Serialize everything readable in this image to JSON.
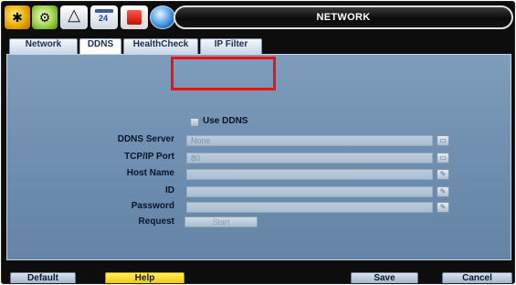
{
  "window": {
    "title": "NETWORK"
  },
  "toolbar": {
    "icons": [
      {
        "name": "setup-icon"
      },
      {
        "name": "gear-icon"
      },
      {
        "name": "alarm-bell-icon"
      },
      {
        "name": "calendar-icon",
        "text": "24"
      },
      {
        "name": "record-icon"
      },
      {
        "name": "network-globe-icon"
      }
    ]
  },
  "tabs": [
    {
      "label": "Network",
      "active": false
    },
    {
      "label": "DDNS",
      "active": true
    },
    {
      "label": "HealthCheck",
      "active": false
    },
    {
      "label": "IP Filter",
      "active": false
    }
  ],
  "ddns": {
    "use_ddns_label": "Use DDNS",
    "use_ddns_checked": false,
    "fields": [
      {
        "label": "DDNS Server",
        "value": "None"
      },
      {
        "label": "TCP/IP Port",
        "value": "80"
      },
      {
        "label": "Host Name",
        "value": ""
      },
      {
        "label": "ID",
        "value": ""
      },
      {
        "label": "Password",
        "value": ""
      }
    ],
    "request_label": "Request",
    "request_button": "Start"
  },
  "footer": {
    "default_label": "Default",
    "help_label": "Help",
    "save_label": "Save",
    "cancel_label": "Cancel"
  },
  "colors": {
    "panel": "#7391b2",
    "highlight": "#ee1111",
    "help_button": "#f5d000",
    "title_bar": "#0b0b0b"
  }
}
